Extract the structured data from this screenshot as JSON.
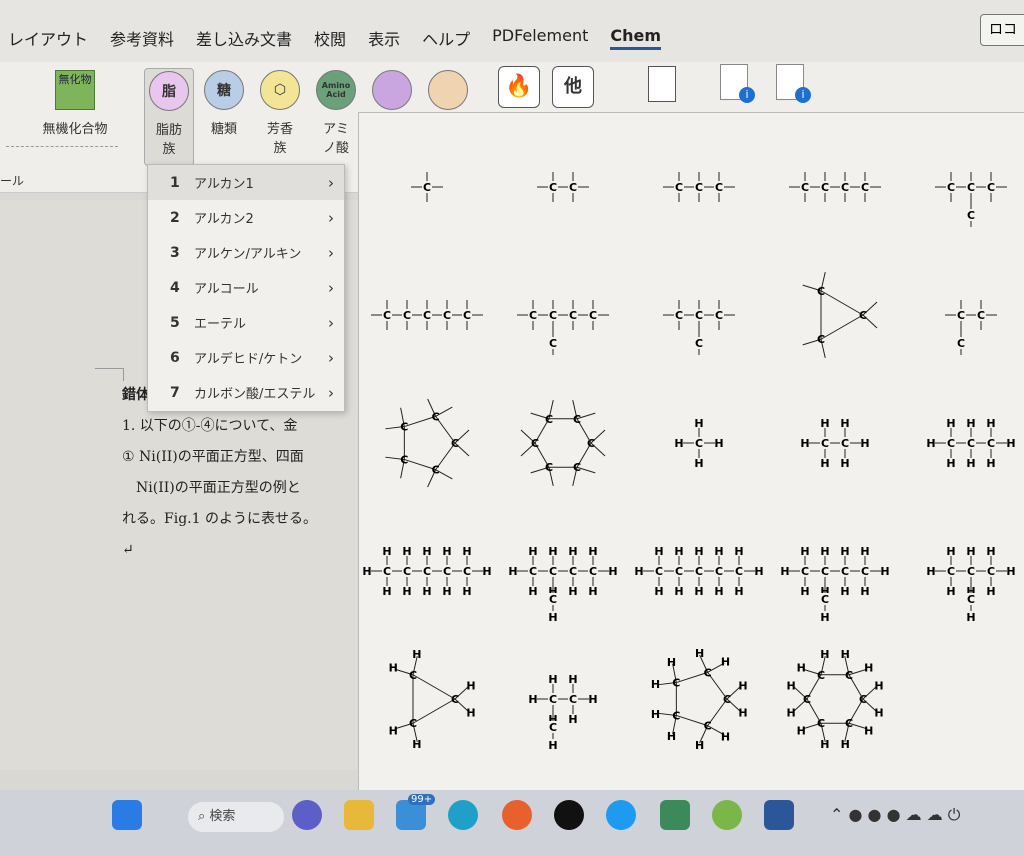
{
  "ribbon_tabs": [
    {
      "label": "レイアウト"
    },
    {
      "label": "参考資料"
    },
    {
      "label": "差し込み文書"
    },
    {
      "label": "校閲"
    },
    {
      "label": "表示"
    },
    {
      "label": "ヘルプ"
    },
    {
      "label": "PDFelement"
    },
    {
      "label": "Chem",
      "active": true
    }
  ],
  "top_right_button": "ロコ",
  "ribbon": {
    "inorganic": {
      "icon_text": "無化物",
      "label": "無機化合物"
    },
    "group_label": "ール",
    "buttons": [
      {
        "icon_text": "脂",
        "label": "脂肪族",
        "color": "#e9c6ee"
      },
      {
        "icon_text": "糖",
        "label": "糖類",
        "color": "#b9cde6"
      },
      {
        "icon_text": "⬡",
        "label": "芳香族",
        "color": "#f2e596"
      },
      {
        "icon_text": "Amino Acid",
        "label": "アミノ酸",
        "color": "#6aa07a"
      },
      {
        "icon_text": "",
        "label": "",
        "color": "#c9a6e0"
      },
      {
        "icon_text": "",
        "label": "",
        "color": "#f0d3b0"
      }
    ],
    "other_label": "他"
  },
  "menu": {
    "items": [
      {
        "num": "1",
        "label": "アルカン1"
      },
      {
        "num": "2",
        "label": "アルカン2"
      },
      {
        "num": "3",
        "label": "アルケン/アルキン"
      },
      {
        "num": "4",
        "label": "アルコール"
      },
      {
        "num": "5",
        "label": "エーテル"
      },
      {
        "num": "6",
        "label": "アルデヒド/ケトン"
      },
      {
        "num": "7",
        "label": "カルボン酸/エステル"
      }
    ]
  },
  "document": {
    "lines": [
      "錯体",
      "1. 以下の①-④について、金",
      "① Ni(II)の平面正方型、四面",
      "　Ni(II)の平面正方型の例と",
      "れる。Fig.1 のように表せる。",
      "↵"
    ]
  },
  "gallery": [
    {
      "c": 1,
      "h": false
    },
    {
      "c": 2,
      "h": false
    },
    {
      "c": 3,
      "h": false
    },
    {
      "c": 4,
      "h": false
    },
    {
      "c": 3,
      "h": false,
      "branch": true
    },
    {
      "c": 5,
      "h": false
    },
    {
      "c": 4,
      "h": false,
      "branch": true
    },
    {
      "c": 3,
      "h": false,
      "branch": true
    },
    {
      "c": 3,
      "h": false,
      "ring": true
    },
    {
      "c": 2,
      "h": false,
      "branch": true
    },
    {
      "c": 5,
      "h": false,
      "ring": true
    },
    {
      "c": 6,
      "h": false,
      "ring": true
    },
    {
      "c": 1,
      "h": true
    },
    {
      "c": 2,
      "h": true
    },
    {
      "c": 3,
      "h": true
    },
    {
      "c": 5,
      "h": true
    },
    {
      "c": 4,
      "h": true,
      "branch": true
    },
    {
      "c": 5,
      "h": true
    },
    {
      "c": 4,
      "h": true,
      "branch": true
    },
    {
      "c": 3,
      "h": true,
      "branch": true
    },
    {
      "c": 3,
      "h": true,
      "ring": true
    },
    {
      "c": 2,
      "h": true,
      "branch": true
    },
    {
      "c": 5,
      "h": true,
      "ring": true
    },
    {
      "c": 6,
      "h": true,
      "ring": true
    }
  ],
  "taskbar": {
    "search_label": "検索",
    "mail_badge": "99+"
  }
}
